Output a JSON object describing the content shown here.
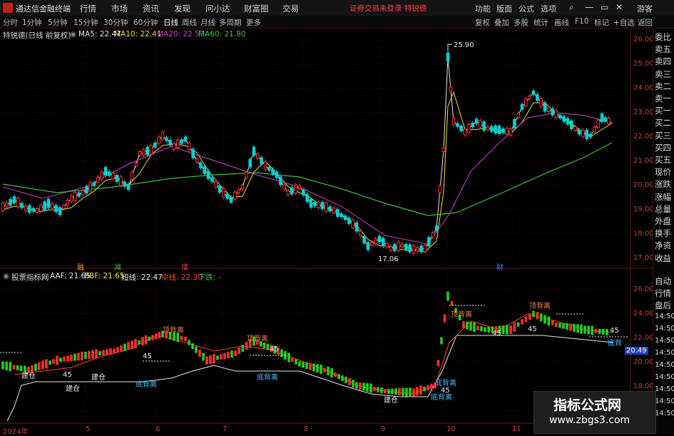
{
  "menubar": {
    "app_title": "通达信金融终端",
    "items": [
      "行情",
      "市场",
      "资讯",
      "发现",
      "问小达",
      "财富圈",
      "交易"
    ],
    "notice": "证券交易未登录  特锐德",
    "right_items": [
      "功能",
      "版面",
      "公式",
      "选项"
    ],
    "login": "游客"
  },
  "periodbar": {
    "periods": [
      "分时",
      "1分钟",
      "5分钟",
      "15分钟",
      "30分钟",
      "60分钟",
      "日线",
      "周线",
      "月线",
      "多周期",
      "更多"
    ],
    "active": "日线",
    "tools": [
      "复权",
      "叠加",
      "多股",
      "统计",
      "画线",
      "F10",
      "标记",
      "+自选",
      "返回"
    ]
  },
  "main_chart": {
    "stock_label": "特锐德(日线 前复权)",
    "ma": [
      {
        "label": "MA5: 22.47",
        "color": "#e8e8e8"
      },
      {
        "label": "MA10: 22.41",
        "color": "#f0e040"
      },
      {
        "label": "MA20: 22.57",
        "color": "#d040d0"
      },
      {
        "label": "MA60: 21.80",
        "color": "#40c040"
      }
    ],
    "high_label": "25.90",
    "low_label": "17.06",
    "markers": [
      {
        "text": "融",
        "color": "#f0a020"
      },
      {
        "text": "减",
        "color": "#40c040"
      },
      {
        "text": "增",
        "color": "#f04040"
      },
      {
        "text": "财",
        "color": "#4080ff"
      }
    ],
    "y_ticks": [
      "26.00",
      "25.00",
      "24.00",
      "23.00",
      "22.00",
      "21.00",
      "20.00",
      "19.00",
      "18.00",
      "17.00"
    ]
  },
  "sub_chart": {
    "indicator": "股票指标网",
    "values": [
      {
        "label": "AAF: 21.65",
        "color": "#e8e8e8"
      },
      {
        "label": "BBF: 21.65",
        "color": "#f0e040"
      },
      {
        "label": "短线: 22.47",
        "color": "#e8e8e8"
      },
      {
        "label": "中线: 22.30",
        "color": "#ff4040"
      },
      {
        "label": "下跌: -",
        "color": "#40c040"
      }
    ],
    "y_ticks": [
      "26.00",
      "24.00",
      "22.00",
      "20.49",
      "20.00",
      "18.00"
    ],
    "current_value": "20.49",
    "signals": [
      {
        "text": "顶背离",
        "color": "#f08040"
      },
      {
        "text": "顶背离",
        "color": "#f08040"
      },
      {
        "text": "顶背离",
        "color": "#f08040"
      },
      {
        "text": "顶背离",
        "color": "#f08040"
      },
      {
        "text": "底背离",
        "color": "#40c0ff"
      },
      {
        "text": "底背离",
        "color": "#40c0ff"
      },
      {
        "text": "底背离",
        "color": "#40c0ff"
      },
      {
        "text": "底背离",
        "color": "#40c0ff"
      },
      {
        "text": "底背",
        "color": "#40c0ff"
      },
      {
        "text": "建仓",
        "color": "#e8e8e8"
      },
      {
        "text": "建仓",
        "color": "#e8e8e8"
      },
      {
        "text": "建仓",
        "color": "#e8e8e8"
      },
      {
        "text": "建仓",
        "color": "#e8e8e8"
      },
      {
        "text": "45",
        "color": "#e8e8e8"
      },
      {
        "text": "45",
        "color": "#e8e8e8"
      },
      {
        "text": "45",
        "color": "#e8e8e8"
      },
      {
        "text": "45",
        "color": "#e8e8e8"
      },
      {
        "text": "45",
        "color": "#e8e8e8"
      },
      {
        "text": "45",
        "color": "#e8e8e8"
      },
      {
        "text": "45",
        "color": "#e8e8e8"
      }
    ]
  },
  "x_axis": [
    "2024年",
    "5",
    "6",
    "7",
    "8",
    "9",
    "10",
    "11"
  ],
  "right_panel": {
    "items": [
      "委比",
      "卖五",
      "卖四",
      "卖三",
      "卖二",
      "卖一",
      "买一",
      "买二",
      "买三",
      "买四",
      "买五",
      "现价",
      "涨跌",
      "涨幅",
      "总量",
      "外盘",
      "换手",
      "净资",
      "收益"
    ],
    "items2": [
      "自动",
      "行情",
      "盘后"
    ],
    "times": [
      "14:50",
      "14:50",
      "14:50",
      "14:50",
      "14:50",
      "14:50",
      "14:50",
      "14:50",
      "14:50"
    ]
  },
  "watermark": {
    "title": "指标公式网",
    "url": "www.zbgs3.com"
  },
  "colors": {
    "up": "#ff3030",
    "down": "#00d0d0",
    "grid": "#4a1010",
    "ma5": "#e8e8e8",
    "ma10": "#f0e040",
    "ma20": "#d040d0",
    "ma60": "#40c040"
  }
}
